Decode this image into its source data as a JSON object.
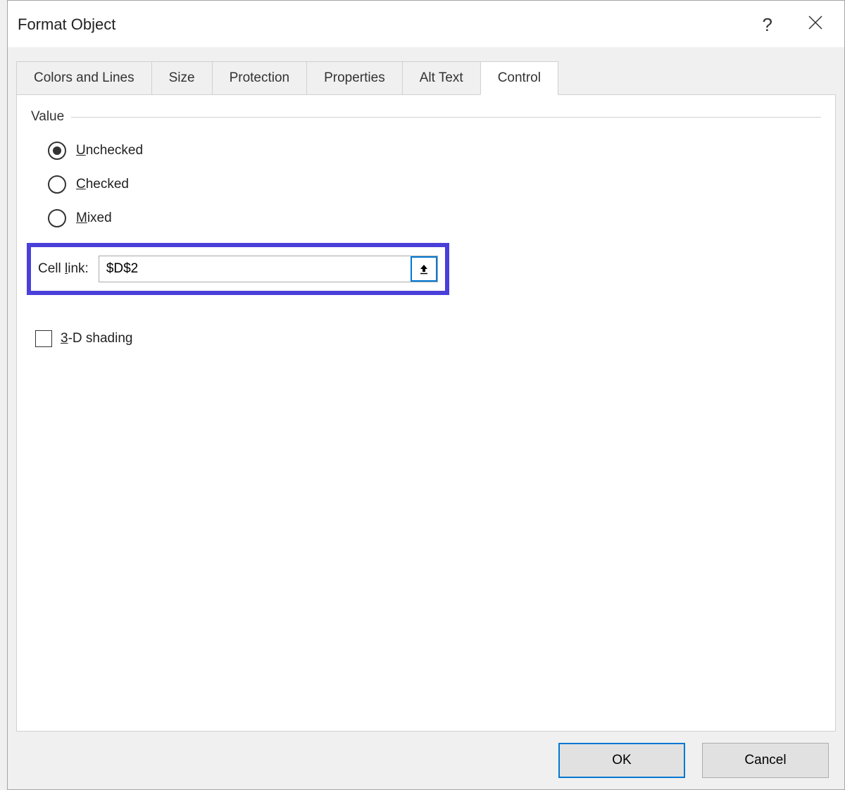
{
  "dialog": {
    "title": "Format Object"
  },
  "tabs": {
    "colors_lines": "Colors and Lines",
    "size": "Size",
    "protection": "Protection",
    "properties": "Properties",
    "alt_text": "Alt Text",
    "control": "Control"
  },
  "control": {
    "value_group_label": "Value",
    "radio": {
      "unchecked": "nchecked",
      "unchecked_key": "U",
      "checked": "hecked",
      "checked_key": "C",
      "mixed": "ixed",
      "mixed_key": "M"
    },
    "cell_link_label_pre": "Cell ",
    "cell_link_label_key": "l",
    "cell_link_label_post": "ink:",
    "cell_link_value": "$D$2",
    "shading_key": "3",
    "shading_rest": "-D shading"
  },
  "buttons": {
    "ok": "OK",
    "cancel": "Cancel"
  }
}
